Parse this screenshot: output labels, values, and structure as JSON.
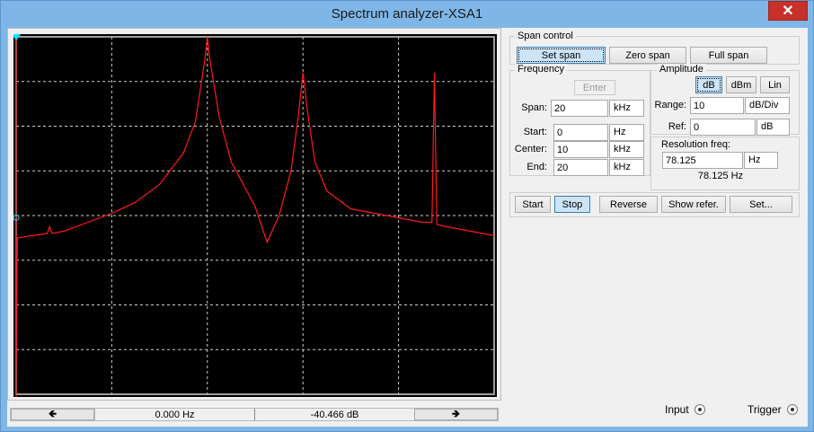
{
  "window": {
    "title": "Spectrum analyzer-XSA1",
    "close_label": "✕"
  },
  "span_control": {
    "title": "Span control",
    "buttons": [
      "Set span",
      "Zero span",
      "Full span"
    ],
    "active": "Set span"
  },
  "frequency": {
    "title": "Frequency",
    "enter_label": "Enter",
    "span": {
      "label": "Span:",
      "value": "20",
      "unit": "kHz"
    },
    "start": {
      "label": "Start:",
      "value": "0",
      "unit": "Hz"
    },
    "center": {
      "label": "Center:",
      "value": "10",
      "unit": "kHz"
    },
    "end": {
      "label": "End:",
      "value": "20",
      "unit": "kHz"
    }
  },
  "amplitude": {
    "title": "Amplitude",
    "buttons": [
      "dB",
      "dBm",
      "Lin"
    ],
    "active": "dB",
    "range": {
      "label": "Range:",
      "value": "10",
      "unit": "dB/Div"
    },
    "ref": {
      "label": "Ref:",
      "value": "0",
      "unit": "dB"
    }
  },
  "resolution": {
    "title": "Resolution freq:",
    "value": "78.125",
    "unit": "Hz",
    "display": "78.125  Hz"
  },
  "actions": {
    "start": "Start",
    "stop": "Stop",
    "reverse": "Reverse",
    "show_refer": "Show refer.",
    "set": "Set..."
  },
  "cursor": {
    "left_arrow": "🡸",
    "right_arrow": "🡺",
    "frequency": "0.000  Hz",
    "amplitude": "-40.466  dB"
  },
  "terminals": {
    "input": "Input",
    "trigger": "Trigger"
  },
  "colors": {
    "trace": "#ff1a1a",
    "screen_bg": "#000000",
    "grid": "#d0d0d0",
    "cursor_marker": "#00e5ff",
    "title_bar": "#7fb6e8"
  },
  "chart_data": {
    "type": "line",
    "xlim": [
      0,
      20000
    ],
    "x_unit": "Hz",
    "ylim": [
      -80,
      0
    ],
    "y_unit": "dB",
    "grid": true,
    "grid_divisions": {
      "x": 10,
      "y": 8
    },
    "series": [
      {
        "x": [
          0,
          50,
          1300,
          1400,
          1500,
          2000,
          3000,
          4000,
          5000,
          6000,
          7000,
          7500,
          7900,
          8000,
          8100,
          8500,
          9000,
          10000,
          10500,
          11000,
          11500,
          11800,
          12000,
          12200,
          12500,
          13000,
          14000,
          15000,
          16000,
          17000,
          17400,
          17500,
          17600,
          18000,
          19000,
          20000
        ],
        "y": [
          -75,
          -45,
          -44,
          -42.5,
          -44,
          -43.5,
          -41.5,
          -39.5,
          -37,
          -33,
          -26,
          -19,
          -5,
          0,
          -5,
          -18,
          -28,
          -38,
          -46,
          -40,
          -30,
          -18,
          -8,
          -17,
          -28,
          -34.5,
          -38.5,
          -39.5,
          -40.5,
          -41.5,
          -41.5,
          -8,
          -42,
          -42.5,
          -43.5,
          -44.5
        ]
      }
    ]
  }
}
